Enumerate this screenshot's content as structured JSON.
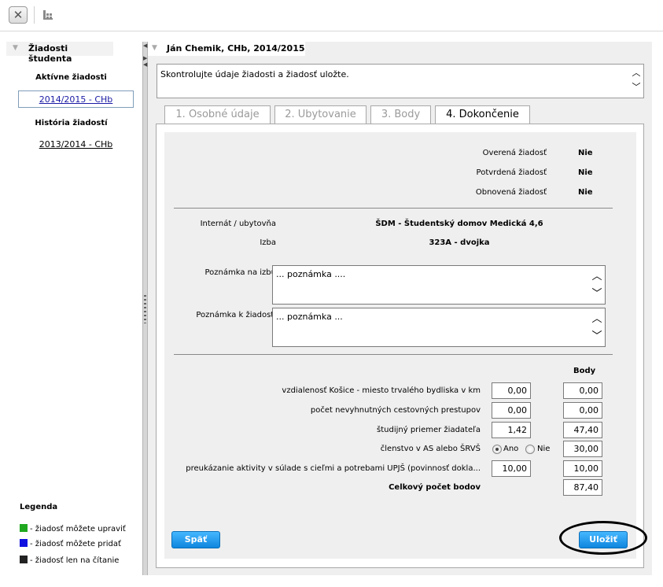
{
  "toolbar": {
    "close_glyph": "✕"
  },
  "sidebar": {
    "title": "Žiadosti študenta",
    "active_heading": "Aktívne žiadosti",
    "active_item": "2014/2015 - CHb",
    "history_heading": "História žiadostí",
    "history_item": "2013/2014 - CHb",
    "legend": {
      "title": "Legenda",
      "items": [
        {
          "label": "- žiadosť môžete upraviť",
          "color": "#1fa81f"
        },
        {
          "label": "- žiadosť môžete pridať",
          "color": "#1010e0"
        },
        {
          "label": "- žiadosť len na čítanie",
          "color": "#222222"
        }
      ]
    }
  },
  "main": {
    "title": "Ján Chemik, CHb, 2014/2015",
    "info": "Skontrolujte údaje žiadosti a žiadosť uložte.",
    "tabs": [
      {
        "label": "1. Osobné údaje"
      },
      {
        "label": "2. Ubytovanie"
      },
      {
        "label": "3. Body"
      },
      {
        "label": "4. Dokončenie"
      }
    ],
    "status": [
      {
        "label": "Overená žiadosť",
        "value": "Nie"
      },
      {
        "label": "Potvrdená žiadosť",
        "value": "Nie"
      },
      {
        "label": "Obnovená žiadosť",
        "value": "Nie"
      }
    ],
    "dorm_label": "Internát / ubytovňa",
    "dorm_value": "ŠDM - Študentský domov Medická 4,6",
    "room_label": "Izba",
    "room_value": "323A - dvojka",
    "note_room_label": "Poznámka na izbu",
    "note_room_value": "... poznámka ....",
    "note_req_label": "Poznámka k žiadosti",
    "note_req_value": "... poznámka ...",
    "points_header": "Body",
    "points": [
      {
        "label": "vzdialenosť Košice - miesto trvalého bydliska v km",
        "input": "0,00",
        "body": "0,00"
      },
      {
        "label": "počet nevyhnutných cestovných prestupov",
        "input": "0,00",
        "body": "0,00"
      },
      {
        "label": "študijný priemer žiadateľa",
        "input": "1,42",
        "body": "47,40"
      },
      {
        "label": "členstvo v AS alebo ŠRVŠ",
        "radio_yes": "Ano",
        "radio_no": "Nie",
        "selected": "Ano",
        "body": "30,00"
      },
      {
        "label": "preukázanie aktivity v súlade s cieľmi a potrebami UPJŠ (povinnosť dokla...",
        "input": "10,00",
        "body": "10,00"
      }
    ],
    "total_label": "Celkový počet bodov",
    "total_value": "87,40",
    "back_button": "Späť",
    "save_button": "Uložiť"
  }
}
